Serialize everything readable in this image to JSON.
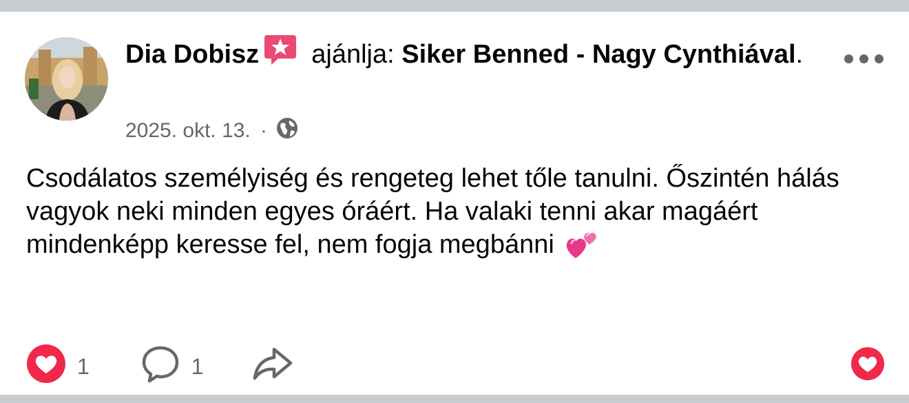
{
  "post": {
    "author": "Dia Dobisz",
    "recommends_text": "ajánlja:",
    "page_name": "Siker Benned - Nagy Cynthiával",
    "period": ".",
    "date": "2025. okt. 13.",
    "separator": "·",
    "visibility_icon": "globe-icon",
    "body": "Csodálatos személyiség és rengeteg lehet tőle tanulni. Őszintén hálás vagyok neki minden egyes óráért. Ha valaki tenni akar magáért mindenképp keresse fel, nem fogja megbánni",
    "emoji": "two-hearts-emoji"
  },
  "actions": {
    "likes": "1",
    "comments": "1"
  },
  "colors": {
    "reaction_red": "#f0284a",
    "secondary_text": "#65676b",
    "divider": "#c9ccd1",
    "badge_pink": "#e84a72"
  }
}
